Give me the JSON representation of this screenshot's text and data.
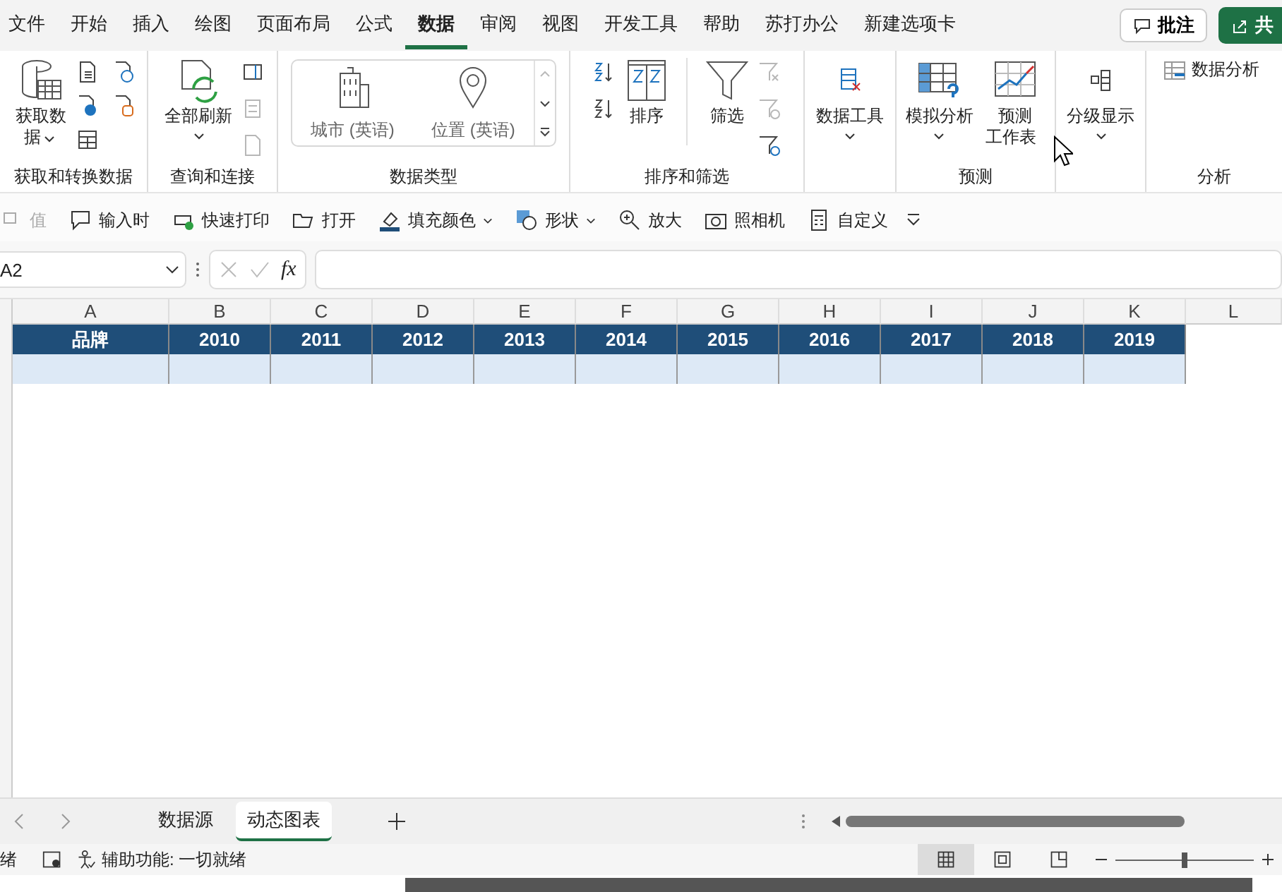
{
  "menu_tabs": [
    {
      "label": "文件",
      "selected": false
    },
    {
      "label": "开始",
      "selected": false
    },
    {
      "label": "插入",
      "selected": false
    },
    {
      "label": "绘图",
      "selected": false
    },
    {
      "label": "页面布局",
      "selected": false
    },
    {
      "label": "公式",
      "selected": false
    },
    {
      "label": "数据",
      "selected": true
    },
    {
      "label": "审阅",
      "selected": false
    },
    {
      "label": "视图",
      "selected": false
    },
    {
      "label": "开发工具",
      "selected": false
    },
    {
      "label": "帮助",
      "selected": false
    },
    {
      "label": "苏打办公",
      "selected": false
    },
    {
      "label": "新建选项卡",
      "selected": false
    }
  ],
  "comment_button": "批注",
  "share_button": "共",
  "ribbon": {
    "get_data": {
      "label": "获取数据",
      "caret": true,
      "group": "获取和转换数据"
    },
    "refresh_all": {
      "label": "全部刷新",
      "caret": true,
      "group": "查询和连接"
    },
    "data_types": {
      "items": [
        "城市 (英语)",
        "位置 (英语)"
      ],
      "group": "数据类型"
    },
    "sort_filter": {
      "sort": "排序",
      "filter": "筛选",
      "group": "排序和筛选"
    },
    "data_tools": {
      "label": "数据工具",
      "caret": true
    },
    "forecast": {
      "what_if": "模拟分析",
      "what_if_caret": true,
      "sheet": "预测工作表",
      "group": "预测"
    },
    "outline": {
      "label": "分级显示",
      "caret": true
    },
    "analysis": {
      "label": "数据分析",
      "group": "分析"
    }
  },
  "quick_toolbar": [
    {
      "label": "值",
      "disabled": true,
      "caret": false
    },
    {
      "label": "输入时",
      "disabled": false,
      "caret": false
    },
    {
      "label": "快速打印",
      "disabled": false,
      "caret": false
    },
    {
      "label": "打开",
      "disabled": false,
      "caret": false
    },
    {
      "label": "填充颜色",
      "disabled": false,
      "caret": true
    },
    {
      "label": "形状",
      "disabled": false,
      "caret": true
    },
    {
      "label": "放大",
      "disabled": false,
      "caret": false
    },
    {
      "label": "照相机",
      "disabled": false,
      "caret": false
    },
    {
      "label": "自定义",
      "disabled": false,
      "caret": false
    }
  ],
  "name_box": "A2",
  "formula_fx": "fx",
  "sheet": {
    "columns": [
      "A",
      "B",
      "C",
      "D",
      "E",
      "F",
      "G",
      "H",
      "I",
      "J",
      "K",
      "L"
    ],
    "rows": [
      {
        "selected": false,
        "cells": [
          "品牌",
          "2010",
          "2011",
          "2012",
          "2013",
          "2014",
          "2015",
          "2016",
          "2017",
          "2018",
          "2019"
        ]
      },
      {
        "selected": true
      }
    ]
  },
  "sheet_tabs": [
    {
      "label": "数据源",
      "selected": false
    },
    {
      "label": "动态图表",
      "selected": true
    }
  ],
  "status_bar": {
    "ready": "绪",
    "accessibility": "辅助功能: 一切就绪",
    "views": [
      {
        "selected": true
      },
      {
        "selected": false
      },
      {
        "selected": false
      }
    ],
    "zoom": {
      "level": 0.5
    }
  }
}
